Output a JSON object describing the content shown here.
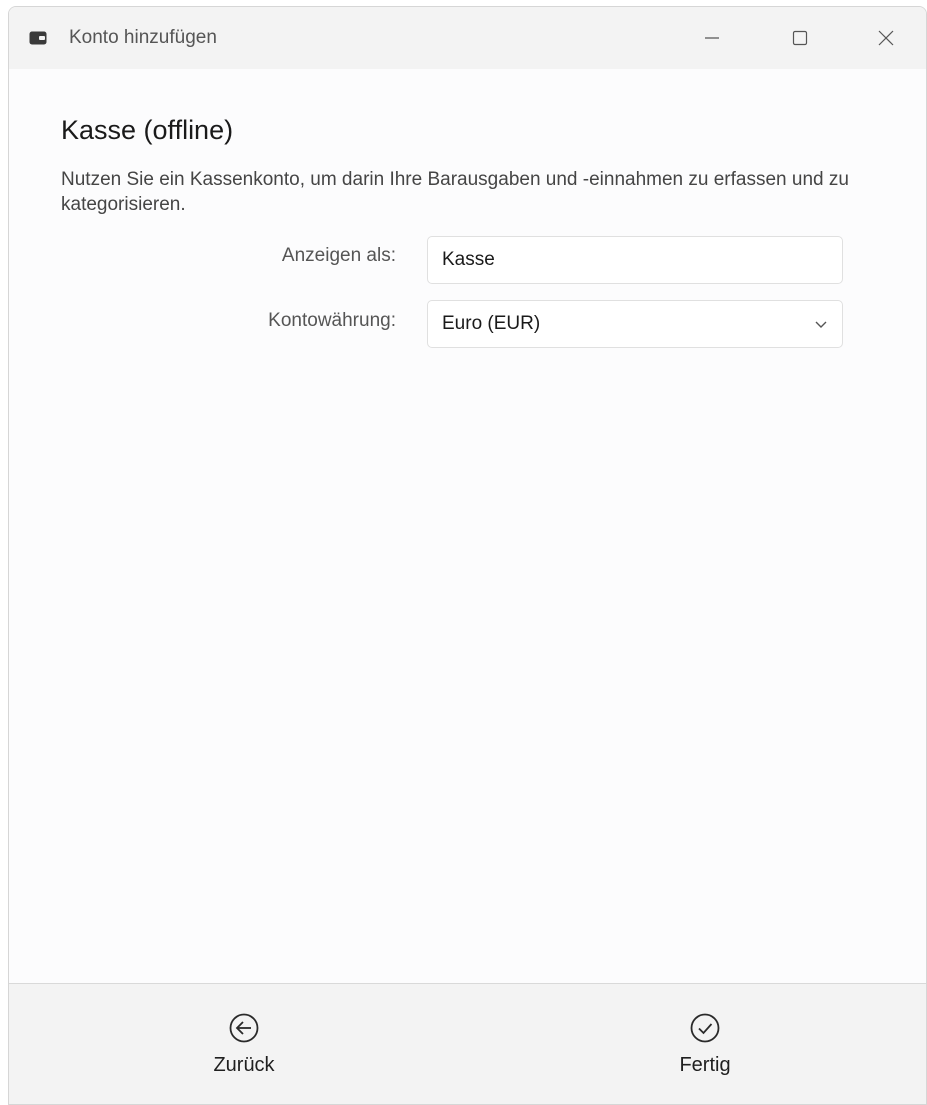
{
  "window": {
    "title": "Konto hinzufügen",
    "title_icon": "wallet-icon",
    "controls": [
      "minimize-icon",
      "maximize-icon",
      "close-icon"
    ]
  },
  "main": {
    "heading": "Kasse (offline)",
    "description": "Nutzen Sie ein Kassenkonto, um darin Ihre Barausgaben und -einnahmen zu erfassen und zu kategorisieren.",
    "fields": {
      "display_name": {
        "label": "Anzeigen als:",
        "value": "Kasse"
      },
      "currency": {
        "label": "Kontowährung:",
        "value": "Euro (EUR)",
        "icon": "chevron-down-icon"
      }
    }
  },
  "footer": {
    "back": {
      "label": "Zurück",
      "icon": "arrow-left-circle-icon"
    },
    "done": {
      "label": "Fertig",
      "icon": "check-circle-icon"
    }
  },
  "colors": {
    "titlebar_bg": "#f3f3f3",
    "content_bg": "#fcfcfd",
    "footer_bg": "#f3f3f3",
    "text_primary": "#1a1a1a",
    "text_secondary": "#555555"
  }
}
